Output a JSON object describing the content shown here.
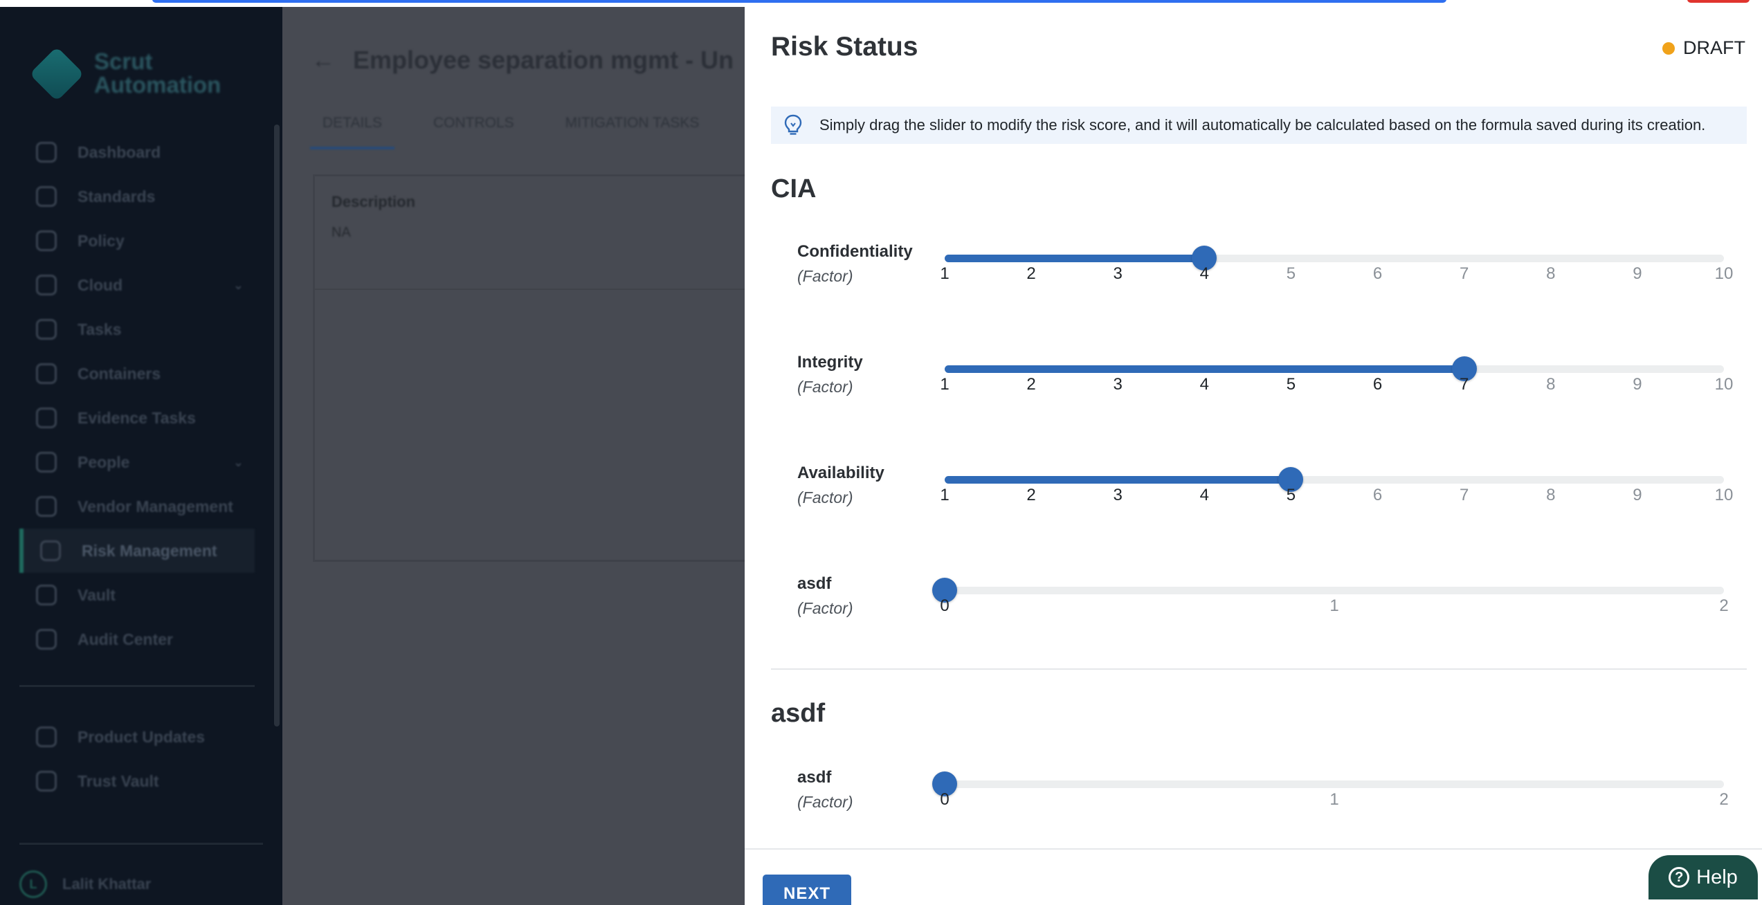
{
  "app": {
    "logo_text": "Scrut Automation",
    "sidebar": {
      "items": [
        {
          "label": "Dashboard",
          "icon": "dashboard-icon"
        },
        {
          "label": "Standards",
          "icon": "standards-icon"
        },
        {
          "label": "Policy",
          "icon": "policy-icon"
        },
        {
          "label": "Cloud",
          "icon": "cloud-icon",
          "has_submenu": true
        },
        {
          "label": "Tasks",
          "icon": "tasks-icon"
        },
        {
          "label": "Containers",
          "icon": "containers-icon"
        },
        {
          "label": "Evidence Tasks",
          "icon": "evidence-icon"
        },
        {
          "label": "People",
          "icon": "people-icon",
          "has_submenu": true
        },
        {
          "label": "Vendor Management",
          "icon": "vendor-icon"
        },
        {
          "label": "Risk Management",
          "icon": "risk-icon",
          "active": true
        },
        {
          "label": "Vault",
          "icon": "vault-icon"
        },
        {
          "label": "Audit Center",
          "icon": "audit-icon"
        }
      ],
      "secondary_items": [
        {
          "label": "Product Updates",
          "icon": "megaphone-icon"
        },
        {
          "label": "Trust Vault",
          "icon": "flag-icon"
        }
      ],
      "user": {
        "name": "Lalit Khattar",
        "initial": "L"
      }
    },
    "page": {
      "title": "Employee separation mgmt - Un",
      "tabs": [
        "DETAILS",
        "CONTROLS",
        "MITIGATION TASKS"
      ],
      "active_tab": "DETAILS",
      "description_label": "Description",
      "description_value": "NA"
    }
  },
  "drawer": {
    "title": "Risk Status",
    "status": {
      "label": "DRAFT",
      "color": "#f0a21a"
    },
    "info": "Simply drag the slider to modify the risk score, and it will automatically be calculated based on the formula saved during its creation.",
    "sections": [
      {
        "title": "CIA",
        "factors": [
          {
            "name": "Confidentiality",
            "sub": "(Factor)",
            "min": 1,
            "max": 10,
            "value": 4,
            "ticks": [
              "1",
              "2",
              "3",
              "4",
              "5",
              "6",
              "7",
              "8",
              "9",
              "10"
            ]
          },
          {
            "name": "Integrity",
            "sub": "(Factor)",
            "min": 1,
            "max": 10,
            "value": 7,
            "ticks": [
              "1",
              "2",
              "3",
              "4",
              "5",
              "6",
              "7",
              "8",
              "9",
              "10"
            ]
          },
          {
            "name": "Availability",
            "sub": "(Factor)",
            "min": 1,
            "max": 10,
            "value": 5,
            "ticks": [
              "1",
              "2",
              "3",
              "4",
              "5",
              "6",
              "7",
              "8",
              "9",
              "10"
            ]
          },
          {
            "name": "asdf",
            "sub": "(Factor)",
            "min": 0,
            "max": 2,
            "value": 0,
            "ticks": [
              "0",
              "1",
              "2"
            ]
          }
        ]
      },
      {
        "title": "asdf",
        "factors": [
          {
            "name": "asdf",
            "sub": "(Factor)",
            "min": 0,
            "max": 2,
            "value": 0,
            "ticks": [
              "0",
              "1",
              "2"
            ]
          }
        ]
      }
    ],
    "next_label": "NEXT",
    "help_label": "Help",
    "accent_color": "#2f6ab7"
  }
}
